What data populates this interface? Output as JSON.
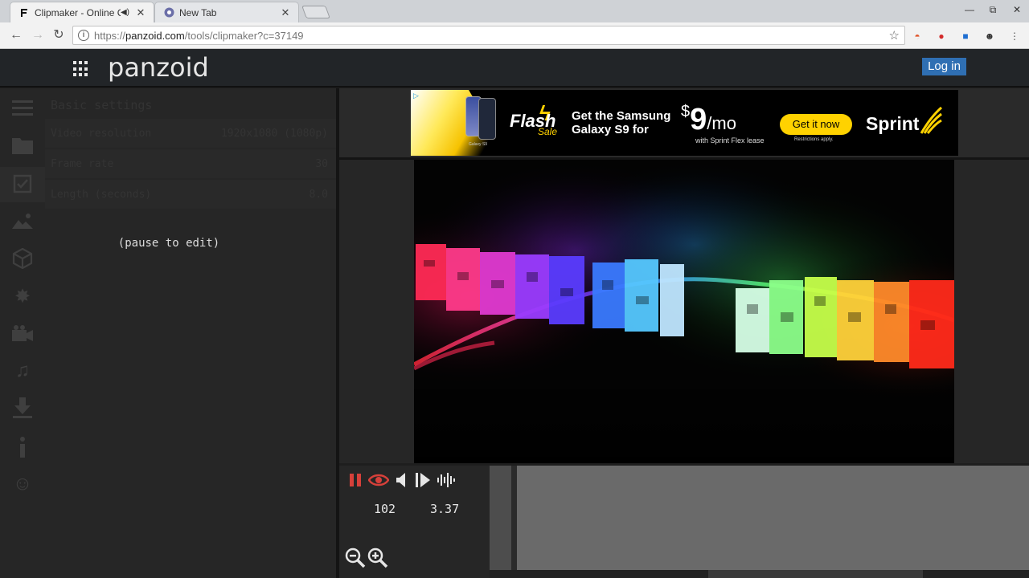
{
  "browser": {
    "tabs": [
      {
        "title": "Clipmaker - Online Cu",
        "favicon": "panzoid-favicon",
        "audio": true
      },
      {
        "title": "New Tab",
        "favicon": "chrome-newtab-icon",
        "audio": false
      }
    ],
    "url_scheme": "https://",
    "url_host": "panzoid.com",
    "url_path": "/tools/clipmaker?c=37149"
  },
  "app": {
    "logo": "panzoid",
    "login_label": "Log in"
  },
  "settings": {
    "heading": "Basic settings",
    "rows": [
      {
        "key": "Video resolution",
        "value": "1920x1080 (1080p)"
      },
      {
        "key": "Frame rate",
        "value": "30"
      },
      {
        "key": "Length (seconds)",
        "value": "8.0"
      }
    ],
    "pause_message": "(pause to edit)"
  },
  "ad": {
    "phone_caption": "Galaxy S9",
    "flash": "Flash",
    "sale": "Sale",
    "headline_line1": "Get the Samsung",
    "headline_line2": "Galaxy S9 for",
    "price_dollar": "$",
    "price_amount": "9",
    "price_unit": "/mo",
    "fine_print": "with Sprint Flex lease",
    "cta": "Get it now",
    "restrictions": "Restrictions apply.",
    "brand": "Sprint"
  },
  "controls": {
    "frame": "102",
    "time": "3.37"
  },
  "colors": {
    "accent_red": "#d6403a",
    "login_blue": "#2f6fb3"
  }
}
